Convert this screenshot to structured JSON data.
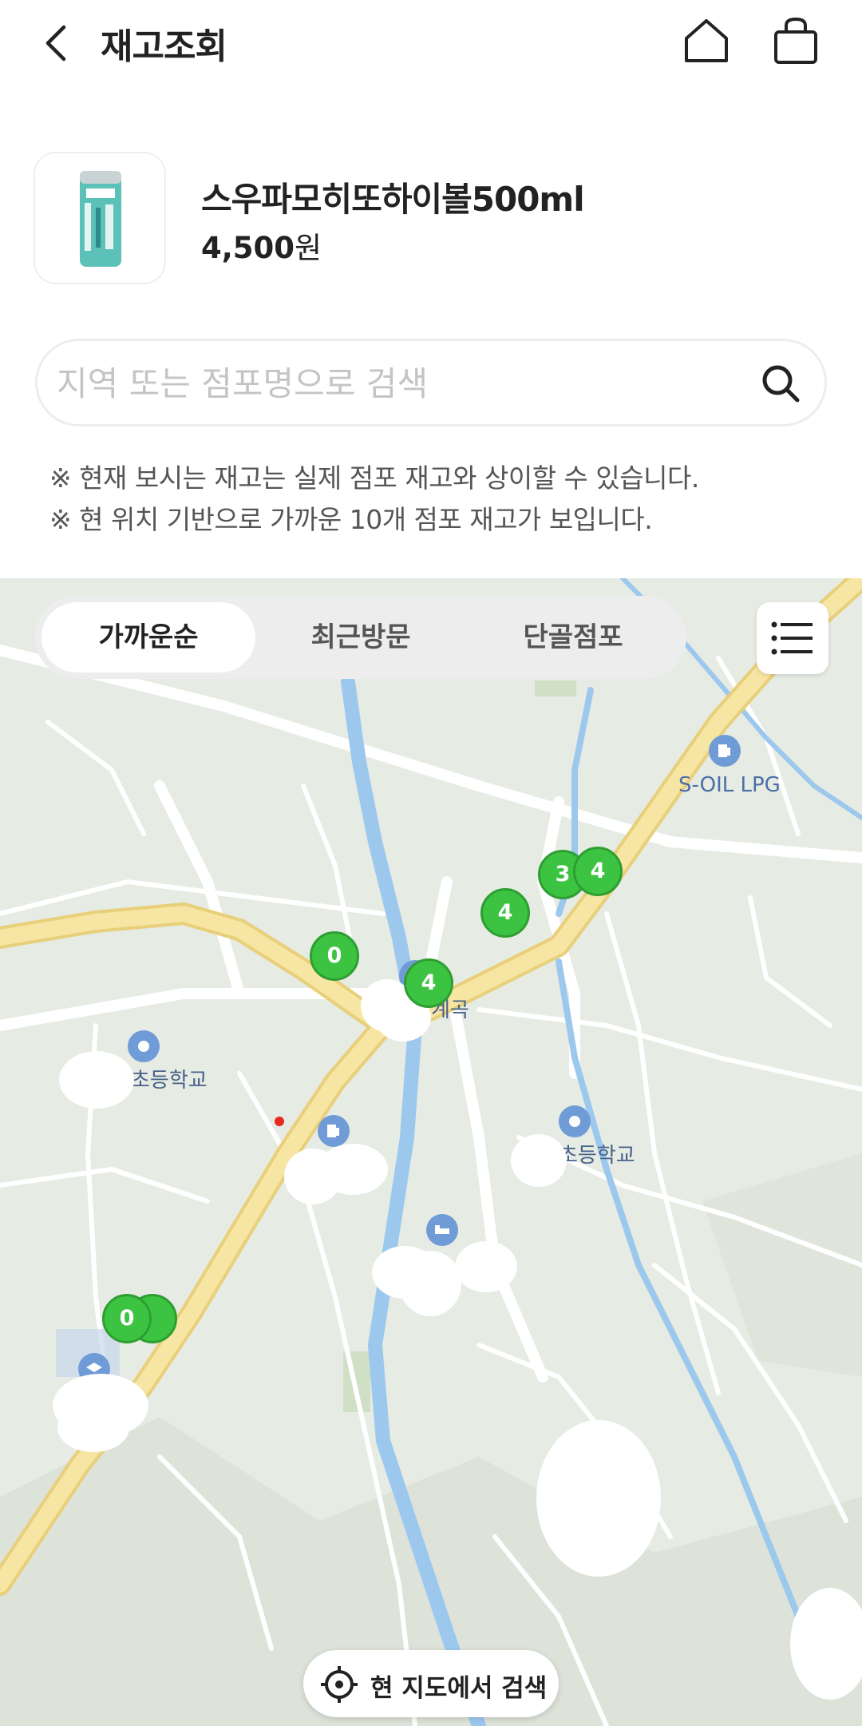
{
  "header": {
    "title": "재고조회"
  },
  "product": {
    "name": "스우파모히또하이볼500ml",
    "price": "4,500",
    "price_unit": "원"
  },
  "search": {
    "placeholder": "지역 또는 점포명으로 검색"
  },
  "notices": [
    "※ 현재 보시는 재고는 실제 점포 재고와 상이할 수 있습니다.",
    "※ 현 위치 기반으로 가까운 10개 점포 재고가 보입니다."
  ],
  "tabs": [
    {
      "label": "가까운순",
      "active": true
    },
    {
      "label": "최근방문",
      "active": false
    },
    {
      "label": "단골점포",
      "active": false
    }
  ],
  "map": {
    "markers": [
      "3",
      "4",
      "4",
      "0",
      "4",
      "0"
    ],
    "labels": {
      "lpg": "S-OIL LPG",
      "school1": "초등학교",
      "school2": "초등학교",
      "area": "계곡"
    },
    "search_button": "현 지도에서 검색"
  },
  "colors": {
    "marker": "#3cc341",
    "road": "#f6e19a",
    "river": "#9dc8ee"
  }
}
